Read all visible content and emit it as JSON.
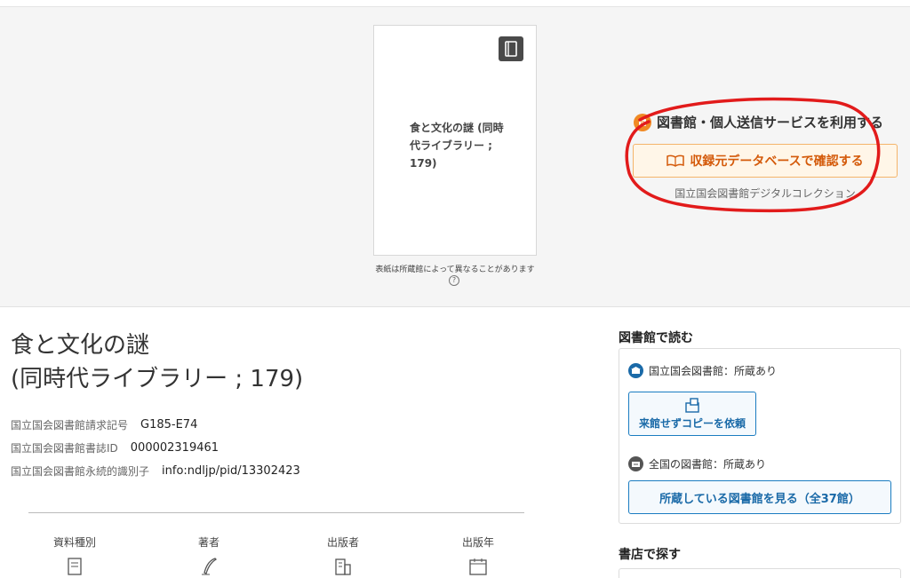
{
  "cover": {
    "title": "食と文化の謎 (同時代ライブラリー ; 179)",
    "note": "表紙は所蔵館によって異なることがあります",
    "help": "?",
    "badge_icon": "book-icon"
  },
  "service": {
    "heading": "図書館・個人送信サービスを利用する",
    "db_button_label": "収録元データベースで確認する",
    "db_name": "国立国会図書館デジタルコレクション",
    "accent_color": "#f08a24"
  },
  "book": {
    "title_line1": "食と文化の謎",
    "title_line2": "(同時代ライブラリー ; 179)",
    "meta": [
      {
        "label": "国立国会図書館請求記号",
        "value": "G185-E74"
      },
      {
        "label": "国立国会図書館書誌ID",
        "value": "000002319461"
      },
      {
        "label": "国立国会図書館永続的識別子",
        "value": "info:ndljp/pid/13302423"
      }
    ],
    "categories": [
      {
        "label": "資料種別",
        "icon": "material-type-icon"
      },
      {
        "label": "著者",
        "icon": "author-pen-icon"
      },
      {
        "label": "出版者",
        "icon": "publisher-building-icon"
      },
      {
        "label": "出版年",
        "icon": "calendar-icon"
      }
    ]
  },
  "sidebar": {
    "read_heading": "図書館で読む",
    "ndl_status": "国立国会図書館：所蔵あり",
    "copy_button": "来館せずコピーを依頼",
    "national_status": "全国の図書館：所蔵あり",
    "libraries_button": "所蔵している図書館を見る（全37館）",
    "shop_heading": "書店で探す",
    "link_color": "#1a6aa8"
  }
}
